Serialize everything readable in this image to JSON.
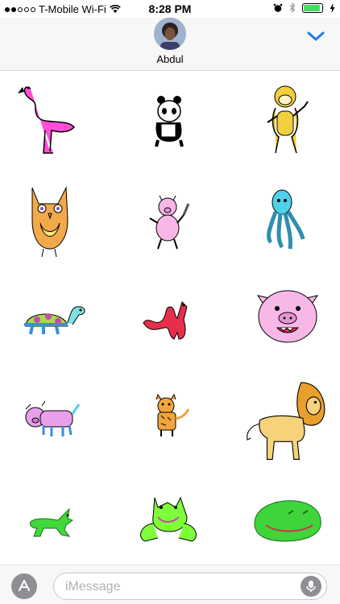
{
  "status_bar": {
    "carrier": "T-Mobile Wi-Fi",
    "time": "8:28 PM",
    "battery_level": 0.9,
    "signal_bars_filled": 2,
    "signal_bars_total": 5
  },
  "header": {
    "contact_name": "Abdul",
    "icons": [
      "avatar",
      "chevron-down-icon"
    ]
  },
  "stickers": [
    {
      "name": "flamingo",
      "color": "#ff4fd8"
    },
    {
      "name": "panda",
      "color": "#000000"
    },
    {
      "name": "monkey",
      "color": "#f2cf3c"
    },
    {
      "name": "owl",
      "color": "#f3a94a"
    },
    {
      "name": "pig-with-knife",
      "color": "#f7b8e8"
    },
    {
      "name": "octopus",
      "color": "#4fd1e8"
    },
    {
      "name": "turtle",
      "color": "#a8d84a"
    },
    {
      "name": "red-dragon",
      "color": "#e62f4a"
    },
    {
      "name": "pig-face",
      "color": "#f7b8e8"
    },
    {
      "name": "purple-pig",
      "color": "#e8a0ea"
    },
    {
      "name": "tiger",
      "color": "#f2a53c"
    },
    {
      "name": "lion",
      "color": "#f6d37a"
    },
    {
      "name": "green-dog",
      "color": "#40d83a"
    },
    {
      "name": "frog",
      "color": "#7dff3a"
    },
    {
      "name": "green-blob",
      "color": "#3ed43a"
    }
  ],
  "input_bar": {
    "placeholder": "iMessage",
    "value": "",
    "icons": [
      "app-store-icon",
      "microphone-icon"
    ]
  },
  "colors": {
    "accent": "#1e7cf2",
    "battery": "#4cd964"
  }
}
